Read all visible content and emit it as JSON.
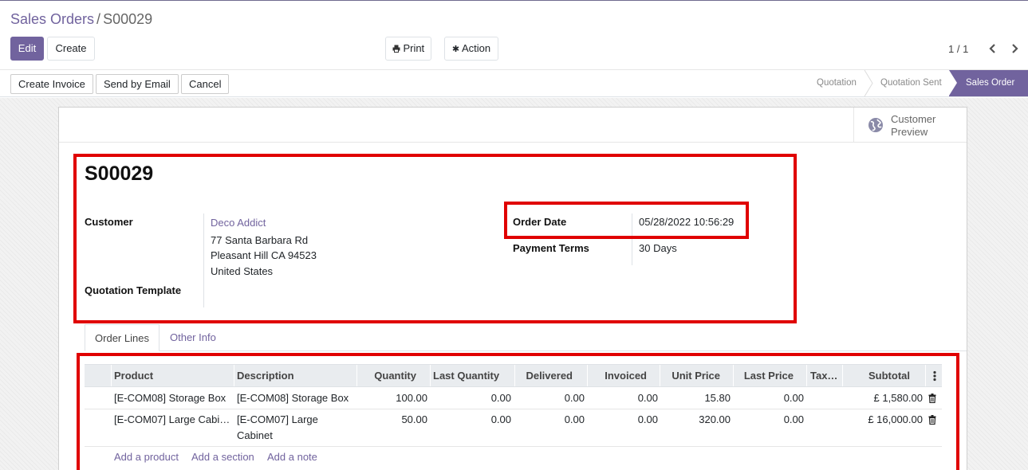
{
  "breadcrumb": {
    "parent": "Sales Orders",
    "separator": "/",
    "current": "S00029"
  },
  "toolbar": {
    "edit": "Edit",
    "create": "Create",
    "print": "Print",
    "action": "Action",
    "pager": "1 / 1"
  },
  "statusbar": {
    "buttons": [
      "Create Invoice",
      "Send by Email",
      "Cancel"
    ],
    "stages": [
      "Quotation",
      "Quotation Sent",
      "Sales Order"
    ],
    "active_stage": "Sales Order"
  },
  "smart_button": {
    "line1": "Customer",
    "line2": "Preview"
  },
  "order": {
    "name": "S00029",
    "customer_label": "Customer",
    "customer_name": "Deco Addict",
    "address_lines": [
      "77 Santa Barbara Rd",
      "Pleasant Hill CA 94523",
      "United States"
    ],
    "quotation_template_label": "Quotation Template",
    "order_date_label": "Order Date",
    "order_date": "05/28/2022 10:56:29",
    "payment_terms_label": "Payment Terms",
    "payment_terms": "30 Days"
  },
  "tabs": [
    "Order Lines",
    "Other Info"
  ],
  "table": {
    "columns": [
      "Product",
      "Description",
      "Quantity",
      "Last Quantity",
      "Delivered",
      "Invoiced",
      "Unit Price",
      "Last Price",
      "Tax…",
      "Subtotal"
    ],
    "rows": [
      {
        "product": "[E-COM08] Storage Box",
        "description": [
          "[E-COM08] Storage Box"
        ],
        "quantity": "100.00",
        "last_quantity": "0.00",
        "delivered": "0.00",
        "invoiced": "0.00",
        "unit_price": "15.80",
        "last_price": "0.00",
        "taxes": "",
        "subtotal": "£ 1,580.00"
      },
      {
        "product": "[E-COM07] Large Cabi…",
        "description": [
          "[E-COM07] Large",
          "Cabinet"
        ],
        "quantity": "50.00",
        "last_quantity": "0.00",
        "delivered": "0.00",
        "invoiced": "0.00",
        "unit_price": "320.00",
        "last_price": "0.00",
        "taxes": "",
        "subtotal": "£ 16,000.00"
      }
    ],
    "add_links": [
      "Add a product",
      "Add a section",
      "Add a note"
    ]
  },
  "colors": {
    "brand": "#71639e",
    "highlight": "#e00000"
  }
}
